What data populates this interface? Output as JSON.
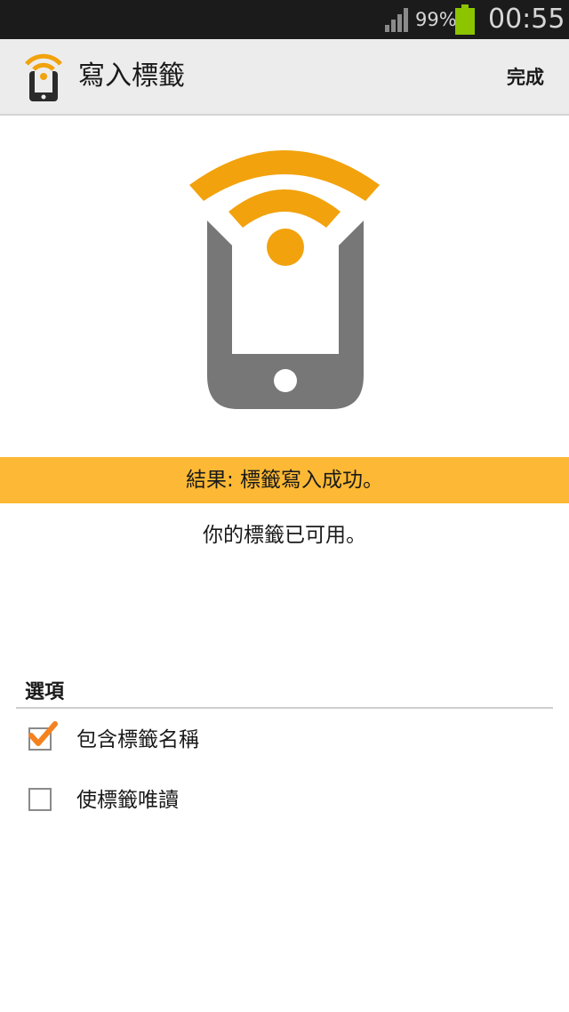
{
  "status_bar": {
    "battery_percent": "99%",
    "time": "00:55",
    "icons": [
      "signal-icon",
      "battery-icon"
    ],
    "battery_color": "#8cc400"
  },
  "action_bar": {
    "title": "寫入標籤",
    "done_label": "完成",
    "app_icon": "nfc-phone-icon"
  },
  "hero": {
    "icon": "nfc-phone-icon",
    "accent_color": "#f2a20c",
    "phone_color": "#777777"
  },
  "result": {
    "banner_text": "結果: 標籤寫入成功。",
    "banner_color": "#fdb935",
    "message": "你的標籤已可用。"
  },
  "options": {
    "header": "選項",
    "items": [
      {
        "label": "包含標籤名稱",
        "checked": true
      },
      {
        "label": "使標籤唯讀",
        "checked": false
      }
    ]
  }
}
